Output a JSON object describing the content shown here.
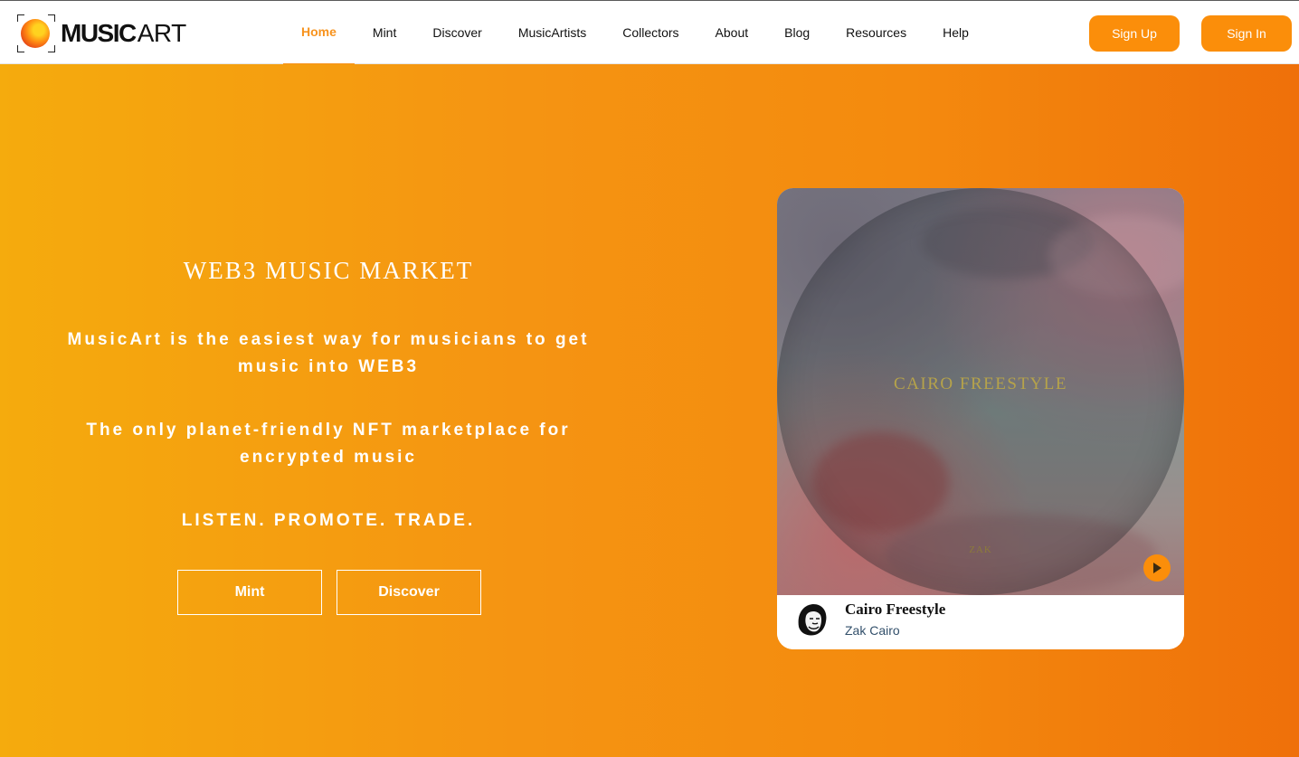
{
  "header": {
    "logo": {
      "text_bold": "MUSIC",
      "text_light": "ART",
      "icon": "musicart-logo-icon"
    },
    "nav": [
      {
        "label": "Home",
        "active": true
      },
      {
        "label": "Mint",
        "active": false
      },
      {
        "label": "Discover",
        "active": false
      },
      {
        "label": "MusicArtists",
        "active": false
      },
      {
        "label": "Collectors",
        "active": false
      },
      {
        "label": "About",
        "active": false
      },
      {
        "label": "Blog",
        "active": false
      },
      {
        "label": "Resources",
        "active": false
      },
      {
        "label": "Help",
        "active": false
      }
    ],
    "signup_label": "Sign Up",
    "signin_label": "Sign In"
  },
  "hero": {
    "title": "WEB3 MUSIC MARKET",
    "tagline1": "MusicArt is the easiest way for musicians to get music into WEB3",
    "tagline2": "The only planet-friendly NFT marketplace for encrypted music",
    "tagline3": "LISTEN. PROMOTE. TRADE.",
    "mint_label": "Mint",
    "discover_label": "Discover"
  },
  "featured_track": {
    "cover_title": "CAIRO FREESTYLE",
    "cover_artist": "ZAK",
    "title": "Cairo Freestyle",
    "artist": "Zak Cairo",
    "play_icon": "play-icon",
    "avatar_icon": "artist-avatar"
  },
  "colors": {
    "accent": "#fb8e0a",
    "active_nav": "#f7931e",
    "hero_start": "#f5ab0d",
    "hero_end": "#ef700a",
    "artist_text": "#33506b"
  }
}
